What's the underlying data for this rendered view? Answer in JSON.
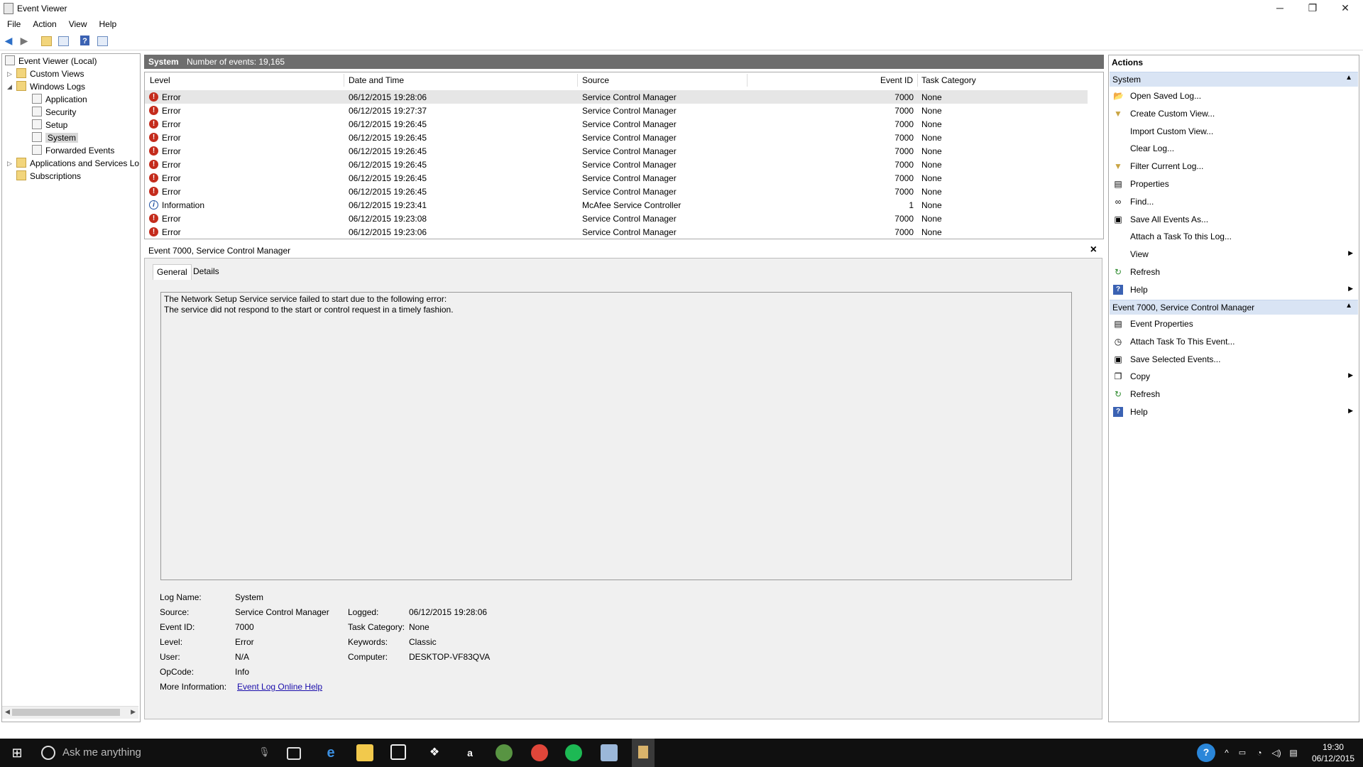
{
  "window": {
    "title": "Event Viewer",
    "min": "─",
    "max": "❐",
    "close": "✕"
  },
  "menu": [
    "File",
    "Action",
    "View",
    "Help"
  ],
  "tree": {
    "root": "Event Viewer (Local)",
    "custom_views": "Custom Views",
    "windows_logs": "Windows Logs",
    "logs": [
      "Application",
      "Security",
      "Setup",
      "System",
      "Forwarded Events"
    ],
    "apps_services": "Applications and Services Lo",
    "subscriptions": "Subscriptions"
  },
  "center_header": {
    "log": "System",
    "count": "Number of events: 19,165"
  },
  "columns": [
    "Level",
    "Date and Time",
    "Source",
    "Event ID",
    "Task Category"
  ],
  "events": [
    {
      "level": "Error",
      "date": "06/12/2015 19:28:06",
      "source": "Service Control Manager",
      "id": "7000",
      "cat": "None"
    },
    {
      "level": "Error",
      "date": "06/12/2015 19:27:37",
      "source": "Service Control Manager",
      "id": "7000",
      "cat": "None"
    },
    {
      "level": "Error",
      "date": "06/12/2015 19:26:45",
      "source": "Service Control Manager",
      "id": "7000",
      "cat": "None"
    },
    {
      "level": "Error",
      "date": "06/12/2015 19:26:45",
      "source": "Service Control Manager",
      "id": "7000",
      "cat": "None"
    },
    {
      "level": "Error",
      "date": "06/12/2015 19:26:45",
      "source": "Service Control Manager",
      "id": "7000",
      "cat": "None"
    },
    {
      "level": "Error",
      "date": "06/12/2015 19:26:45",
      "source": "Service Control Manager",
      "id": "7000",
      "cat": "None"
    },
    {
      "level": "Error",
      "date": "06/12/2015 19:26:45",
      "source": "Service Control Manager",
      "id": "7000",
      "cat": "None"
    },
    {
      "level": "Error",
      "date": "06/12/2015 19:26:45",
      "source": "Service Control Manager",
      "id": "7000",
      "cat": "None"
    },
    {
      "level": "Information",
      "date": "06/12/2015 19:23:41",
      "source": "McAfee Service Controller",
      "id": "1",
      "cat": "None"
    },
    {
      "level": "Error",
      "date": "06/12/2015 19:23:08",
      "source": "Service Control Manager",
      "id": "7000",
      "cat": "None"
    },
    {
      "level": "Error",
      "date": "06/12/2015 19:23:06",
      "source": "Service Control Manager",
      "id": "7000",
      "cat": "None"
    }
  ],
  "details": {
    "header": "Event 7000, Service Control Manager",
    "tabs": [
      "General",
      "Details"
    ],
    "message_line1": "The Network Setup Service service failed to start due to the following error:",
    "message_line2": "The service did not respond to the start or control request in a timely fashion.",
    "labels": {
      "log_name": "Log Name:",
      "source": "Source:",
      "event_id": "Event ID:",
      "level": "Level:",
      "user": "User:",
      "opcode": "OpCode:",
      "more_info": "More Information:",
      "logged": "Logged:",
      "task_category": "Task Category:",
      "keywords": "Keywords:",
      "computer": "Computer:"
    },
    "values": {
      "log_name": "System",
      "source": "Service Control Manager",
      "event_id": "7000",
      "level": "Error",
      "user": "N/A",
      "opcode": "Info",
      "more_info": "Event Log Online Help",
      "logged": "06/12/2015 19:28:06",
      "task_category": "None",
      "keywords": "Classic",
      "computer": "DESKTOP-VF83QVA"
    }
  },
  "actions": {
    "title": "Actions",
    "section1": "System",
    "section1_items": [
      "Open Saved Log...",
      "Create Custom View...",
      "Import Custom View...",
      "Clear Log...",
      "Filter Current Log...",
      "Properties",
      "Find...",
      "Save All Events As...",
      "Attach a Task To this Log...",
      "View",
      "Refresh",
      "Help"
    ],
    "section2": "Event 7000, Service Control Manager",
    "section2_items": [
      "Event Properties",
      "Attach Task To This Event...",
      "Save Selected Events...",
      "Copy",
      "Refresh",
      "Help"
    ]
  },
  "taskbar": {
    "search_placeholder": "Ask me anything",
    "time": "19:30",
    "date": "06/12/2015"
  },
  "colors": {
    "error": "#c42b1c",
    "section_header": "#d9e4f4",
    "header_bar": "#6e6e6e"
  }
}
